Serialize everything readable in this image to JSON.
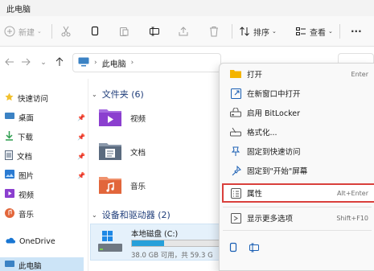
{
  "window": {
    "title": "此电脑"
  },
  "toolbar": {
    "new_label": "新建",
    "sort_label": "排序",
    "view_label": "查看",
    "more_label": "···"
  },
  "address": {
    "crumb": "此电脑"
  },
  "sidebar": {
    "items": [
      {
        "label": "快速访问",
        "icon": "star-icon",
        "color": "#f2c12e",
        "pinned": false
      },
      {
        "label": "桌面",
        "icon": "desktop-icon",
        "color": "#3b82c4",
        "pinned": true
      },
      {
        "label": "下载",
        "icon": "download-icon",
        "color": "#2d9d4e",
        "pinned": true
      },
      {
        "label": "文档",
        "icon": "document-icon",
        "color": "#5b6b7f",
        "pinned": true
      },
      {
        "label": "图片",
        "icon": "pictures-icon",
        "color": "#2b7bd2",
        "pinned": true
      },
      {
        "label": "视频",
        "icon": "videos-icon",
        "color": "#8b3fcf",
        "pinned": false
      },
      {
        "label": "音乐",
        "icon": "music-icon",
        "color": "#e2663b",
        "pinned": false
      },
      {
        "label": "OneDrive",
        "icon": "cloud-icon",
        "color": "#1976d2",
        "pinned": false
      },
      {
        "label": "此电脑",
        "icon": "computer-icon",
        "color": "#3b82c4",
        "pinned": false
      }
    ],
    "pin_glyph": "📌"
  },
  "content": {
    "folders_header": "文件夹 (6)",
    "folders": [
      {
        "label": "视频",
        "icon": "videos-folder-icon",
        "color": "#8b3fcf"
      },
      {
        "label": "文档",
        "icon": "documents-folder-icon",
        "color": "#5b6b7f"
      },
      {
        "label": "音乐",
        "icon": "music-folder-icon",
        "color": "#e2663b"
      }
    ],
    "drives_header": "设备和驱动器 (2)",
    "drive": {
      "name": "本地磁盘 (C:)",
      "free_text": "38.0 GB 可用，共 59.3 G",
      "used_fraction": 0.36
    }
  },
  "context_menu": {
    "items": [
      {
        "label": "打开",
        "shortcut": "Enter",
        "icon": "folder-open-icon",
        "highlighted": false
      },
      {
        "label": "在新窗口中打开",
        "shortcut": "",
        "icon": "new-window-icon",
        "highlighted": false
      },
      {
        "label": "启用 BitLocker",
        "shortcut": "",
        "icon": "bitlocker-icon",
        "highlighted": false
      },
      {
        "label": "格式化...",
        "shortcut": "",
        "icon": "format-icon",
        "highlighted": false
      },
      {
        "label": "固定到快速访问",
        "shortcut": "",
        "icon": "pin-icon",
        "highlighted": false
      },
      {
        "label": "固定到\"开始\"屏幕",
        "shortcut": "",
        "icon": "pin-start-icon",
        "highlighted": false
      },
      {
        "label": "属性",
        "shortcut": "Alt+Enter",
        "icon": "properties-icon",
        "highlighted": true
      },
      {
        "label": "显示更多选项",
        "shortcut": "Shift+F10",
        "icon": "more-options-icon",
        "highlighted": false
      }
    ]
  },
  "colors": {
    "accent": "#0067c0",
    "highlight_border": "#d9403c",
    "drive_fill": "#26a0da"
  }
}
